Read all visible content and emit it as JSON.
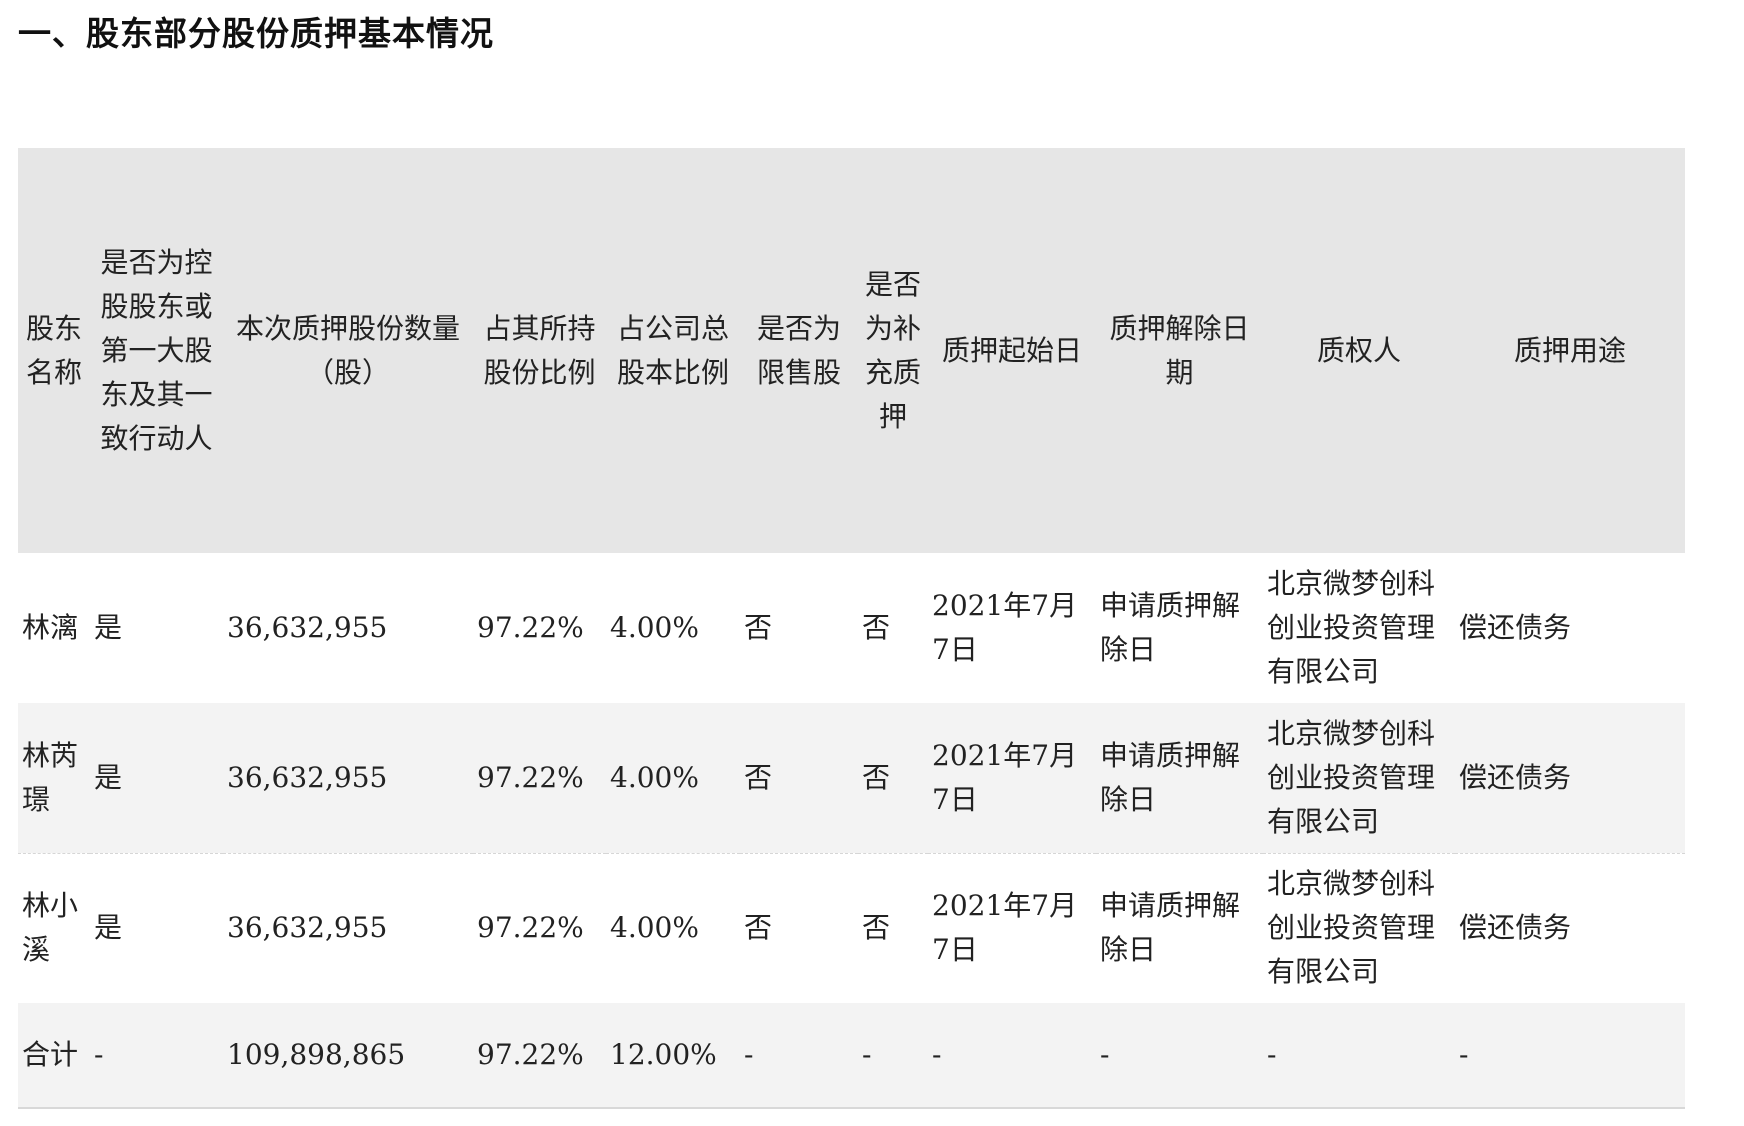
{
  "heading": "一、股东部分股份质押基本情况",
  "table": {
    "headers": [
      "股东名称",
      "是否为控股股东或第一大股东及其一致行动人",
      "本次质押股份数量（股）",
      "占其所持股份比例",
      "占公司总股本比例",
      "是否为限售股",
      "是否为补充质押",
      "质押起始日",
      "质押解除日期",
      "质权人",
      "质押用途"
    ],
    "rows": [
      [
        "林漓",
        "是",
        "36,632,955",
        "97.22%",
        "4.00%",
        "否",
        "否",
        "2021年7月7日",
        "申请质押解除日",
        "北京微梦创科创业投资管理有限公司",
        "偿还债务"
      ],
      [
        "林芮璟",
        "是",
        "36,632,955",
        "97.22%",
        "4.00%",
        "否",
        "否",
        "2021年7月7日",
        "申请质押解除日",
        "北京微梦创科创业投资管理有限公司",
        "偿还债务"
      ],
      [
        "林小溪",
        "是",
        "36,632,955",
        "97.22%",
        "4.00%",
        "否",
        "否",
        "2021年7月7日",
        "申请质押解除日",
        "北京微梦创科创业投资管理有限公司",
        "偿还债务"
      ]
    ],
    "total": [
      "合计",
      "-",
      "109,898,865",
      "97.22%",
      "12.00%",
      "-",
      "-",
      "-",
      "-",
      "-",
      "-"
    ]
  }
}
